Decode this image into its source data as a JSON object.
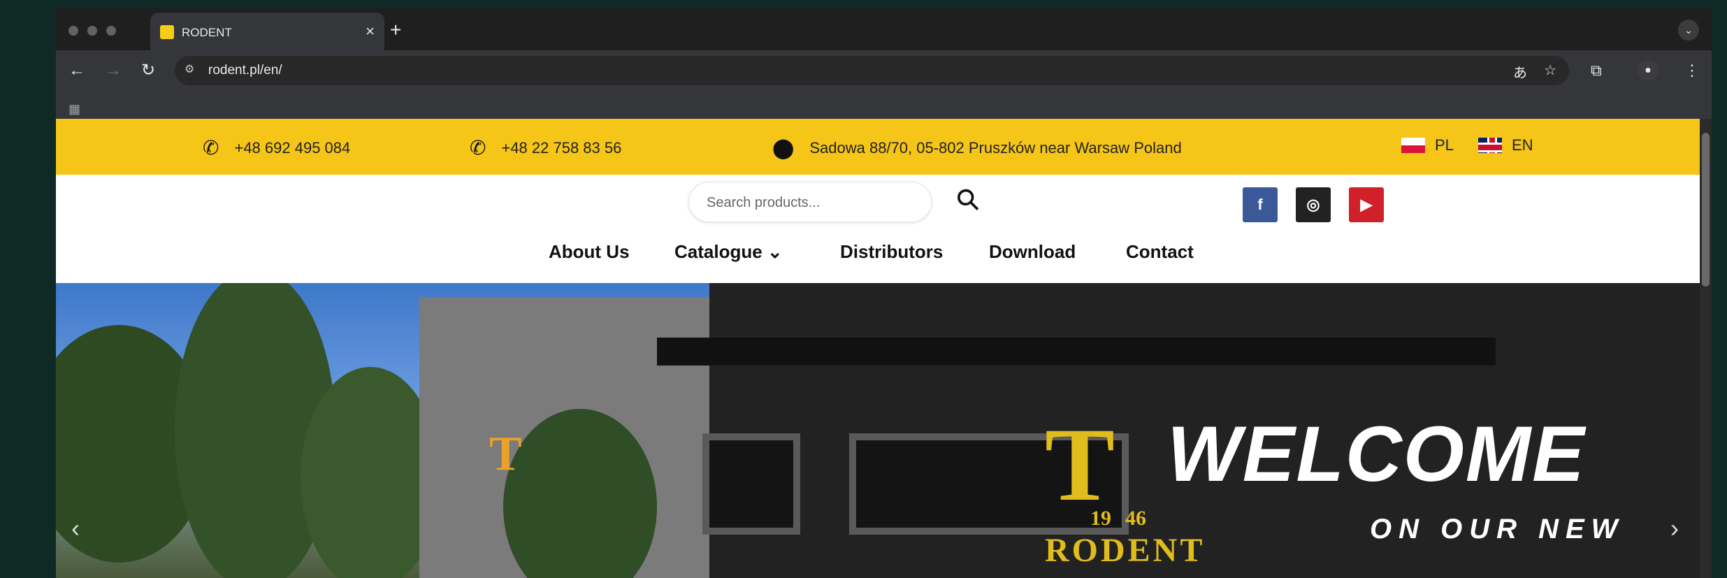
{
  "browser": {
    "tab_title": "RODENT",
    "tab_close": "×",
    "new_tab": "+",
    "tab_menu": "⌄",
    "url": "rodent.pl/en/"
  },
  "topbar": {
    "phone1": "+48 692 495 084",
    "phone2": "+48 22 758 83 56",
    "address": "Sadowa 88/70, 05-802 Pruszków near Warsaw Poland",
    "lang_pl": "PL",
    "lang_en": "EN",
    "accent": "#f5c517"
  },
  "header": {
    "search_placeholder": "Search products...",
    "social": {
      "facebook": "f",
      "instagram": "◎",
      "youtube": "▶",
      "facebook_color": "#3b5998",
      "instagram_color": "#222222",
      "youtube_color": "#d0202a"
    }
  },
  "nav": {
    "about": "About Us",
    "catalogue": "Catalogue",
    "catalogue_chevron": "⌄",
    "distributors": "Distributors",
    "download": "Download",
    "contact": "Contact"
  },
  "hero": {
    "title": "WELCOME",
    "subtitle": "ON OUR NEW",
    "logo_text": "RODENT",
    "logo_year_left": "19",
    "logo_year_right": "46",
    "prev": "‹",
    "next": "›"
  }
}
